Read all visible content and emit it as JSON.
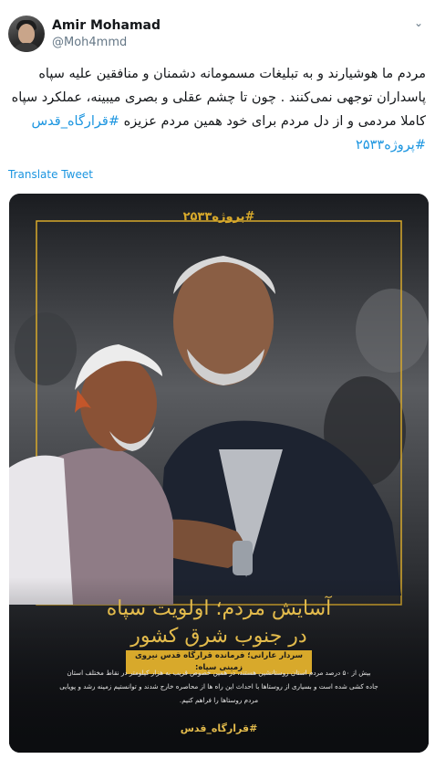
{
  "author": {
    "display_name": "Amir Mohamad",
    "handle": "@Moh4mmd"
  },
  "tweet": {
    "line1": "مردم ما هوشیارند و به تبلیغات مسمومانه دشمنان و منافقین علیه سپاه",
    "line2": "پاسداران توجهی نمی‌کنند . چون تا چشم عقلی و بصری میبینه، عملکرد سپاه",
    "line3_text": "کاملا مردمی و از دل مردم برای خود همین مردم عزیزه",
    "hashtag1": "#قرارگاه_قدس",
    "hashtag2": "#پروژه۲۵۳۳"
  },
  "translate_label": "Translate Tweet",
  "poster": {
    "top_tag": "#پروژه۲۵۳۳",
    "title_line1": "آسایش مردم؛ اولویت سپاه",
    "title_line2": "در جنوب شرق کشور",
    "subtitle": "سردار عارانی؛ فرمانده قرارگاه قدس نیروی زمینی سپاه:",
    "body_line1": "بیش از ۵۰ درصد مردم استان روستانشین هستند، در همین خصوص قریب به هزار کیلومتر در نقاط مختلف استان",
    "body_line2": "جاده کشی شده است و بسیاری از روستاها با احداث این راه ها از محاصره خارج شدند و توانستیم زمینه رشد و پویایی",
    "body_line3": "مردم روستاها را فراهم کنیم.",
    "footer_tag": "#قرارگاه_قدس"
  },
  "colors": {
    "link": "#1b95e0",
    "poster_gold": "#d8a92b",
    "poster_bg": "#101216"
  },
  "icons": {
    "menu": "chevron-down-icon"
  }
}
